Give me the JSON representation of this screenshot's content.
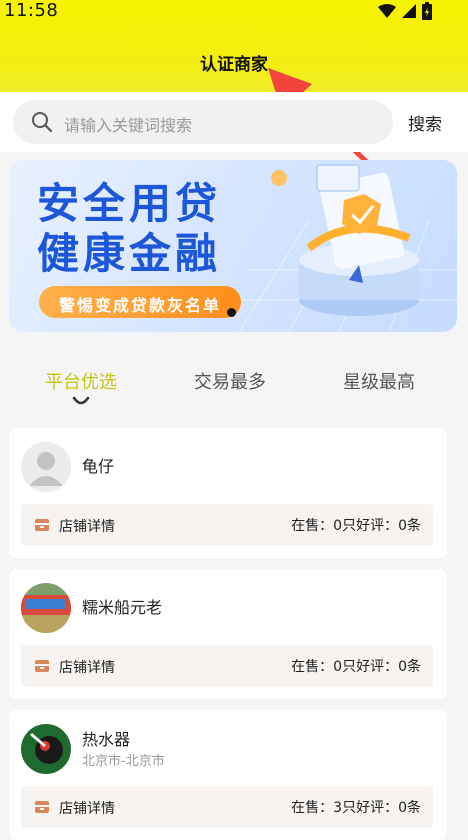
{
  "status": {
    "time": "11:58"
  },
  "header": {
    "title": "认证商家"
  },
  "search": {
    "placeholder": "请输入关键词搜索",
    "button": "搜索"
  },
  "banner": {
    "line1": "安全用贷",
    "line2": "健康金融",
    "pill": "警惕变成贷款灰名单"
  },
  "tabs": [
    {
      "label": "平台优选"
    },
    {
      "label": "交易最多"
    },
    {
      "label": "星级最高"
    }
  ],
  "shops": [
    {
      "name": "龟仔",
      "location": "",
      "detail": "店铺详情",
      "stats": "在售：0只好评：0条"
    },
    {
      "name": "糯米船元老",
      "location": "",
      "detail": "店铺详情",
      "stats": "在售：0只好评：0条"
    },
    {
      "name": "热水器",
      "location": "北京市-北京市",
      "detail": "店铺详情",
      "stats": "在售：3只好评：0条"
    }
  ],
  "colors": {
    "header": "#f6f200",
    "active_tab": "#c8c214",
    "banner_text": "#1c56d9",
    "pill": "#ff9a2a"
  }
}
